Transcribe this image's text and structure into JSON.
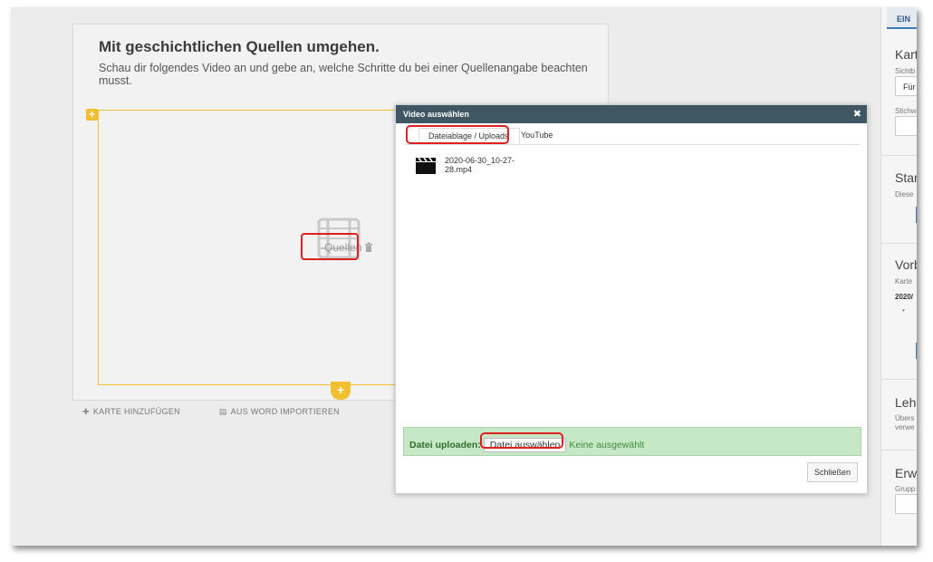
{
  "editor": {
    "title": "Mit geschichtlichen Quellen umgehen.",
    "description": "Schau dir folgendes Video an und gebe an, welche Schritte du bei einer Quellenangabe beachten musst.",
    "element_label": "Quellen",
    "add_card": "KARTE HINZUFÜGEN",
    "import_word": "AUS WORD IMPORTIEREN"
  },
  "right_panel": {
    "tab": "EIN",
    "sections": [
      {
        "heading": "Kart",
        "sub": "Sichtb",
        "value": "Für",
        "sub2": "Stichw"
      },
      {
        "heading": "Star",
        "sub": "Diese"
      },
      {
        "heading": "Vorb",
        "sub": "Karte",
        "extra": "2020/",
        "bullet": "•"
      },
      {
        "heading": "Lehr",
        "sub": "Übers",
        "sub2": "verwe"
      },
      {
        "heading": "Erwe",
        "sub": "Grupp"
      }
    ]
  },
  "dialog": {
    "title": "Video auswählen",
    "close_glyph": "✖",
    "tabs": [
      "Dateiablage / Uploads",
      "YouTube"
    ],
    "file_name": "2020-06-30_10-27-28.mp4",
    "upload_label": "Datei uploaden:",
    "choose_button": "Datei auswählen",
    "no_file": "Keine ausgewählt",
    "close_button": "Schließen"
  },
  "colors": {
    "accent_yellow": "#f0c030",
    "dialog_bar": "#3f5663",
    "upload_bg": "#c7e8c6",
    "highlight_red": "#e02020"
  }
}
